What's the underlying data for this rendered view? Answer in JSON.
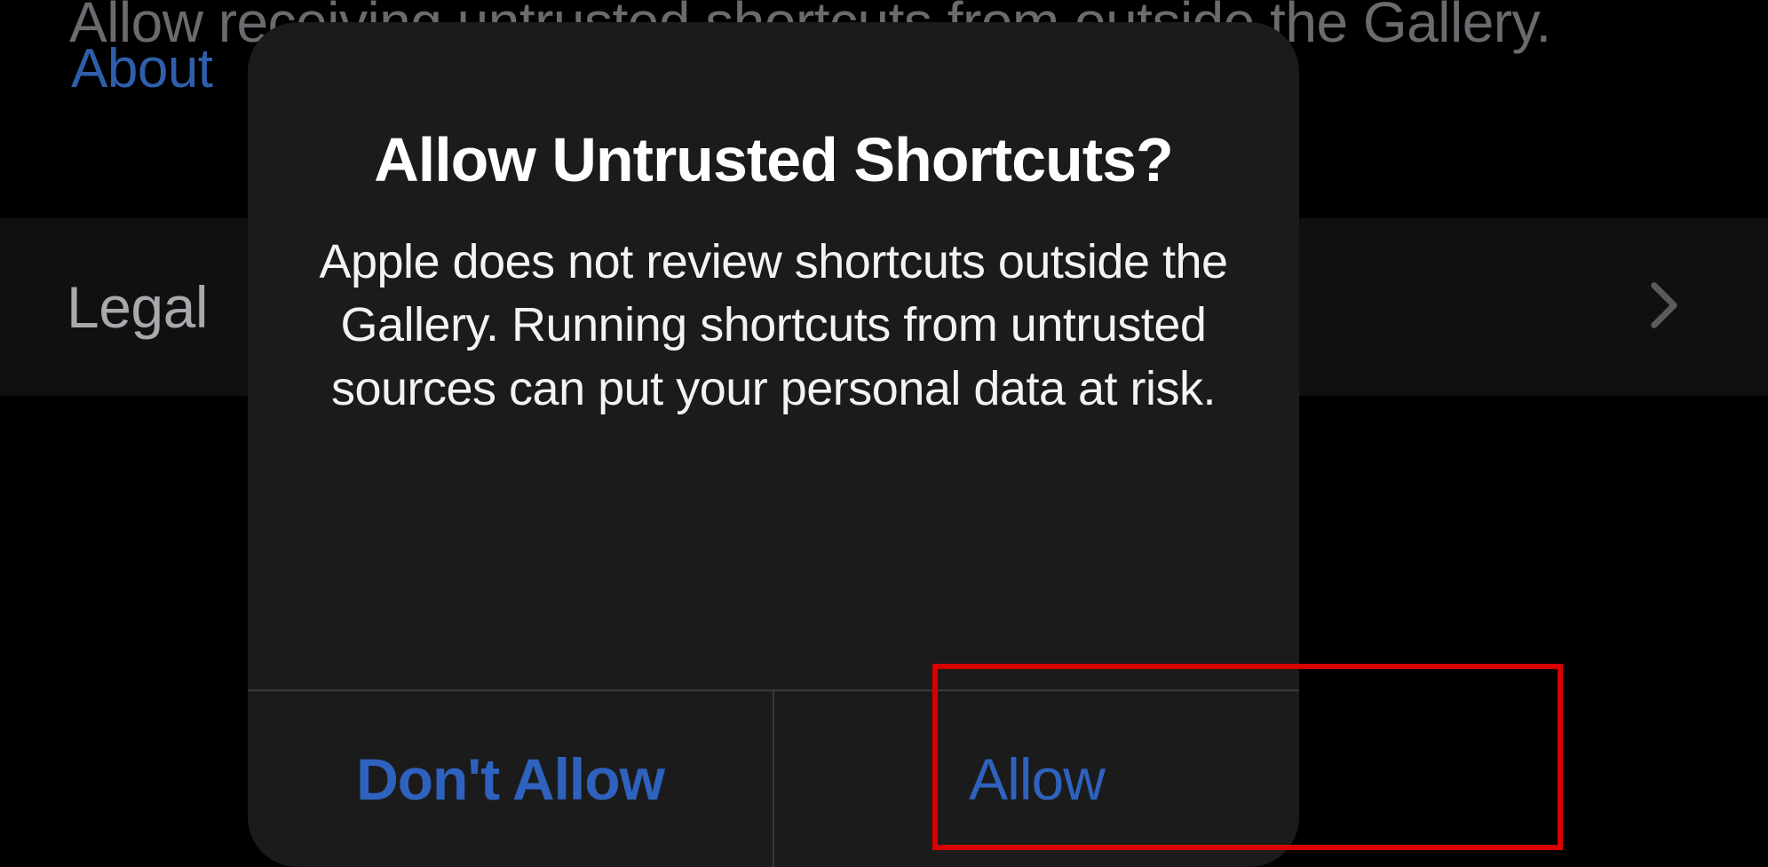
{
  "background": {
    "top_text": "Allow receiving untrusted shortcuts from outside the Gallery.",
    "link_text": "About",
    "row_label": "Legal"
  },
  "dialog": {
    "title": "Allow Untrusted Shortcuts?",
    "message": "Apple does not review shortcuts outside the Gallery. Running shortcuts from untrusted sources can put your personal data at risk.",
    "buttons": {
      "dont_allow": "Don't Allow",
      "allow": "Allow"
    }
  }
}
